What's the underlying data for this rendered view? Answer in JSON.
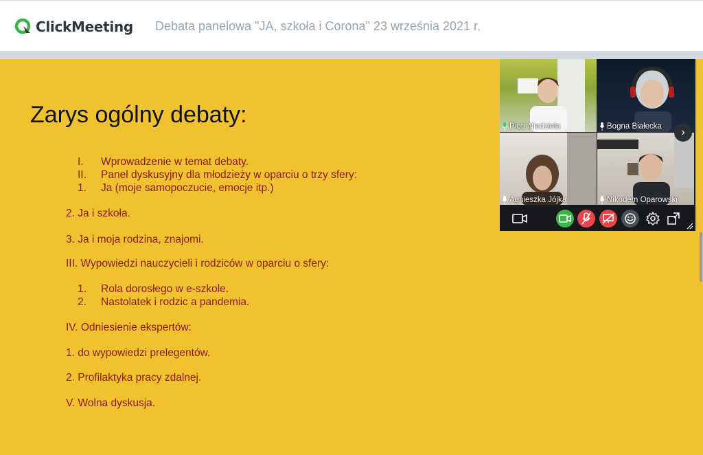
{
  "app": {
    "logo_text": "ClickMeeting",
    "brand_color": "#3bb549"
  },
  "meeting": {
    "title": "Debata panelowa \"JA, szkoła i Corona\" 23 września 2021 r."
  },
  "slide": {
    "title": "Zarys ogólny debaty:",
    "background": "#f0c22f",
    "text_color": "#8b1a10",
    "items": [
      {
        "num": "I.",
        "text": "Wprowadzenie  w temat debaty."
      },
      {
        "num": "II.",
        "text": "Panel dyskusyjny dla młodzieży w oparciu o trzy sfery:"
      },
      {
        "num": "1.",
        "text": "Ja (moje samopoczucie, emocje itp.)"
      },
      {
        "text": "2.   Ja i szkoła."
      },
      {
        "text": "3.  Ja i moja rodzina, znajomi."
      },
      {
        "text": "III. Wypowiedzi nauczycieli i rodziców w oparciu o sfery:"
      },
      {
        "num": "1.",
        "text": "Rola dorosłego w e-szkole."
      },
      {
        "num": "2.",
        "text": "Nastolatek i rodzic a pandemia."
      },
      {
        "text": "IV. Odniesienie ekspertów:"
      },
      {
        "text": "1. do wypowiedzi prelegentów."
      },
      {
        "text": "2. Profilaktyka pracy zdalnej."
      },
      {
        "text": "V. Wolna dyskusja."
      }
    ]
  },
  "participants": [
    {
      "name": "Piotr Niedziela",
      "mic": "active"
    },
    {
      "name": "Bogna Białecka",
      "mic": "active"
    },
    {
      "name": "Agnieszka Jójka",
      "mic": "active"
    },
    {
      "name": "Nikodem Oparowski",
      "mic": "active"
    }
  ],
  "controls": {
    "camera_icon": "camera-icon",
    "video_on_icon": "video-on-icon",
    "mic_off_icon": "mic-off-icon",
    "screen_share_off_icon": "screen-share-off-icon",
    "reactions_icon": "reactions-icon",
    "settings_icon": "gear-icon",
    "fullscreen_icon": "fullscreen-icon",
    "next_icon": "chevron-right-icon"
  }
}
